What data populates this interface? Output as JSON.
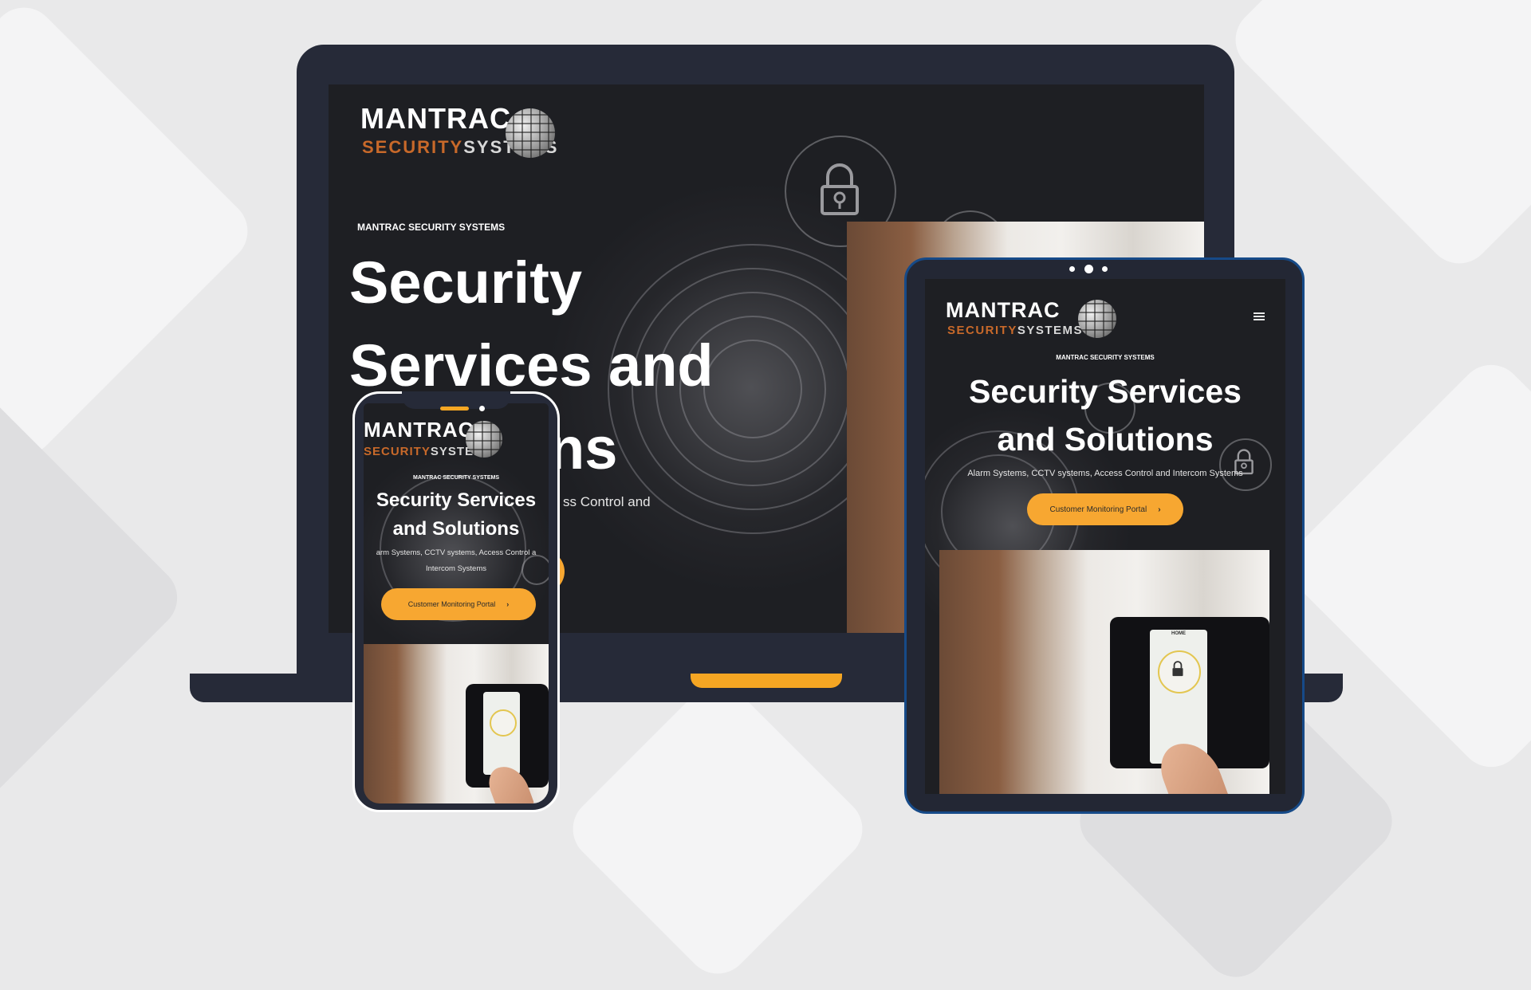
{
  "brand": {
    "name": "MANTRAC",
    "sub_part1": "SECURITY",
    "sub_part2": "SYSTEMS"
  },
  "hero": {
    "eyebrow": "MANTRAC SECURITY SYSTEMS",
    "title_line1": "Security",
    "title_line2": "Services and",
    "title_line3_partial": "ns",
    "title_tablet_line1": "Security Services",
    "title_tablet_line2": "and Solutions",
    "subtitle_laptop_partial": "ss Control and",
    "subtitle": "Alarm Systems, CCTV systems, Access Control and Intercom Systems",
    "subtitle_phone_line1": "arm Systems, CCTV systems, Access Control a",
    "subtitle_phone_line2": "Intercom Systems",
    "cta_label": "Customer Monitoring Portal",
    "cta_chevron": "›"
  },
  "keypad": {
    "label": "HOME"
  },
  "colors": {
    "accent": "#f7a731",
    "device_frame": "#262a38",
    "tablet_border": "#164a88",
    "logo_orange": "#c8692a"
  },
  "icons": {
    "padlock": "padlock-icon",
    "menu": "hamburger-menu-icon",
    "globe": "globe-logo-icon",
    "fingerprint": "fingerprint-graphic"
  }
}
